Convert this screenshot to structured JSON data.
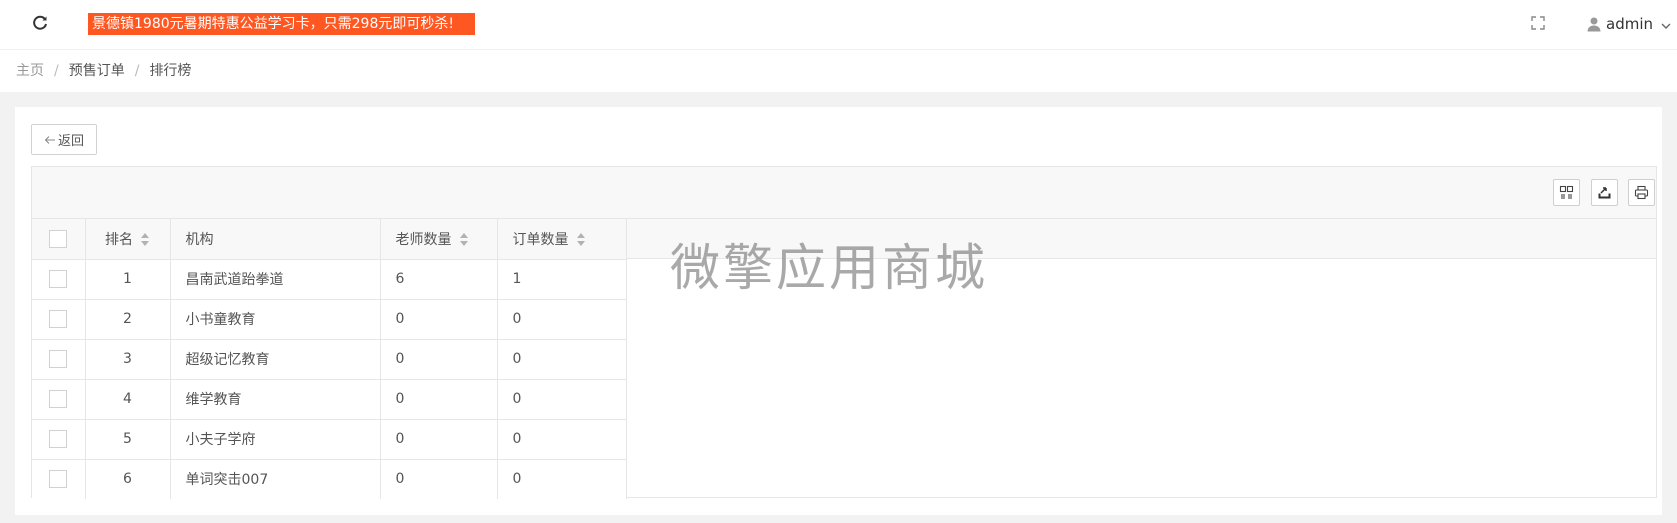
{
  "topbar": {
    "refresh_icon": "refresh-icon",
    "notice": "景德镇1980元暑期特惠公益学习卡，只需298元即可秒杀!",
    "notice_bg": "#ff5722",
    "fullscreen_icon": "fullscreen-icon",
    "user_icon": "user-icon",
    "username": "admin",
    "caret_icon": "chevron-down-icon"
  },
  "breadcrumb": {
    "items": [
      "主页",
      "预售订单",
      "排行榜"
    ],
    "separator": "/"
  },
  "back_button": {
    "label": "返回",
    "icon": "arrow-left-icon"
  },
  "toolbar": {
    "tools": [
      "columns-icon",
      "export-icon",
      "print-icon"
    ]
  },
  "table": {
    "columns": [
      "排名",
      "机构",
      "老师数量",
      "订单数量"
    ],
    "rows": [
      {
        "rank": "1",
        "org": "昌南武道跆拳道",
        "teachers": "6",
        "orders": "1"
      },
      {
        "rank": "2",
        "org": "小书童教育",
        "teachers": "0",
        "orders": "0"
      },
      {
        "rank": "3",
        "org": "超级记忆教育",
        "teachers": "0",
        "orders": "0"
      },
      {
        "rank": "4",
        "org": "维学教育",
        "teachers": "0",
        "orders": "0"
      },
      {
        "rank": "5",
        "org": "小夫子学府",
        "teachers": "0",
        "orders": "0"
      },
      {
        "rank": "6",
        "org": "单词突击007",
        "teachers": "0",
        "orders": "0"
      }
    ]
  },
  "watermark": "微擎应用商城"
}
